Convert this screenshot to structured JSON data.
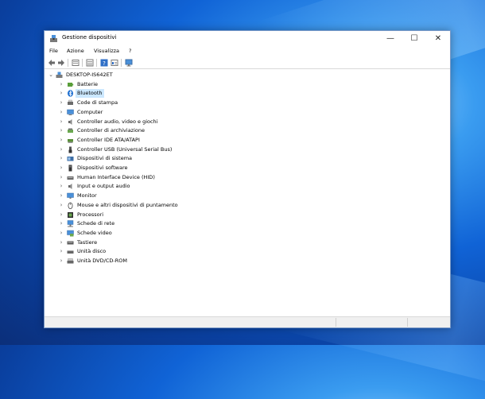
{
  "window": {
    "title": "Gestione dispositivi",
    "controls": {
      "minimize": "—",
      "maximize": "☐",
      "close": "✕"
    }
  },
  "menu": [
    "File",
    "Azione",
    "Visualizza",
    "?"
  ],
  "toolbar_icons": [
    "back-arrow-icon",
    "forward-arrow-icon",
    "properties-icon",
    "tree-view-icon",
    "help-icon",
    "details-icon",
    "monitor-scan-icon"
  ],
  "tree": {
    "root": "DESKTOP-IS642ET",
    "selected": "Bluetooth",
    "items": [
      {
        "label": "Batterie",
        "icon": "battery-icon"
      },
      {
        "label": "Bluetooth",
        "icon": "bluetooth-icon"
      },
      {
        "label": "Code di stampa",
        "icon": "printer-icon"
      },
      {
        "label": "Computer",
        "icon": "computer-icon"
      },
      {
        "label": "Controller audio, video e giochi",
        "icon": "speaker-icon"
      },
      {
        "label": "Controller di archiviazione",
        "icon": "storage-controller-icon"
      },
      {
        "label": "Controller IDE ATA/ATAPI",
        "icon": "ide-controller-icon"
      },
      {
        "label": "Controller USB (Universal Serial Bus)",
        "icon": "usb-icon"
      },
      {
        "label": "Dispositivi di sistema",
        "icon": "system-devices-icon"
      },
      {
        "label": "Dispositivi software",
        "icon": "software-devices-icon"
      },
      {
        "label": "Human Interface Device (HID)",
        "icon": "hid-icon"
      },
      {
        "label": "Input e output audio",
        "icon": "audio-io-icon"
      },
      {
        "label": "Monitor",
        "icon": "monitor-icon"
      },
      {
        "label": "Mouse e altri dispositivi di puntamento",
        "icon": "mouse-icon"
      },
      {
        "label": "Processori",
        "icon": "processor-icon"
      },
      {
        "label": "Schede di rete",
        "icon": "network-adapter-icon"
      },
      {
        "label": "Schede video",
        "icon": "video-card-icon"
      },
      {
        "label": "Tastiere",
        "icon": "keyboard-icon"
      },
      {
        "label": "Unità disco",
        "icon": "disk-drive-icon"
      },
      {
        "label": "Unità DVD/CD-ROM",
        "icon": "dvd-drive-icon"
      }
    ]
  },
  "colors": {
    "selection": "#cce8ff",
    "accent": "#0078d7"
  }
}
